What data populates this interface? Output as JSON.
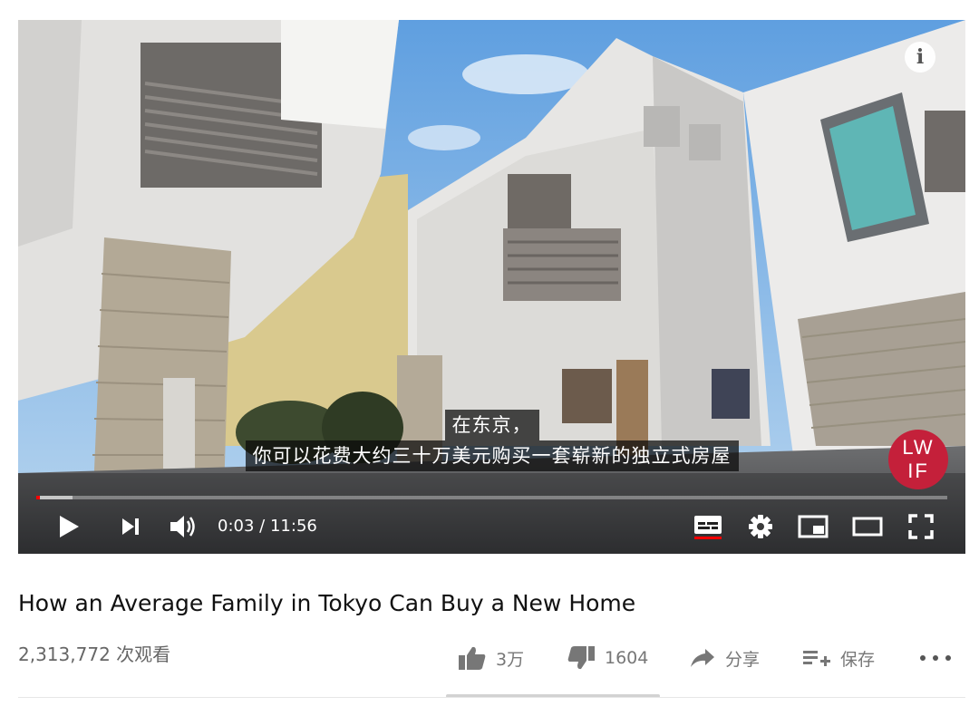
{
  "player": {
    "subtitles": [
      "在东京，",
      "你可以花费大约三十万美元购买一套崭新的独立式房屋"
    ],
    "watermark": "LWIF",
    "current_time": "0:03",
    "separator": "/",
    "duration": "11:56",
    "progress_fraction": 0.004,
    "accent_color": "#ff0000",
    "icons": [
      "info-icon",
      "play-icon",
      "next-icon",
      "volume-icon",
      "captions-icon",
      "settings-icon",
      "miniplayer-icon",
      "theater-icon",
      "fullscreen-icon"
    ]
  },
  "video": {
    "title": "How an Average Family in Tokyo Can Buy a New Home",
    "views": "2,313,772 次观看"
  },
  "actions": {
    "like_count": "3万",
    "dislike_count": "1604",
    "share_label": "分享",
    "save_label": "保存"
  }
}
